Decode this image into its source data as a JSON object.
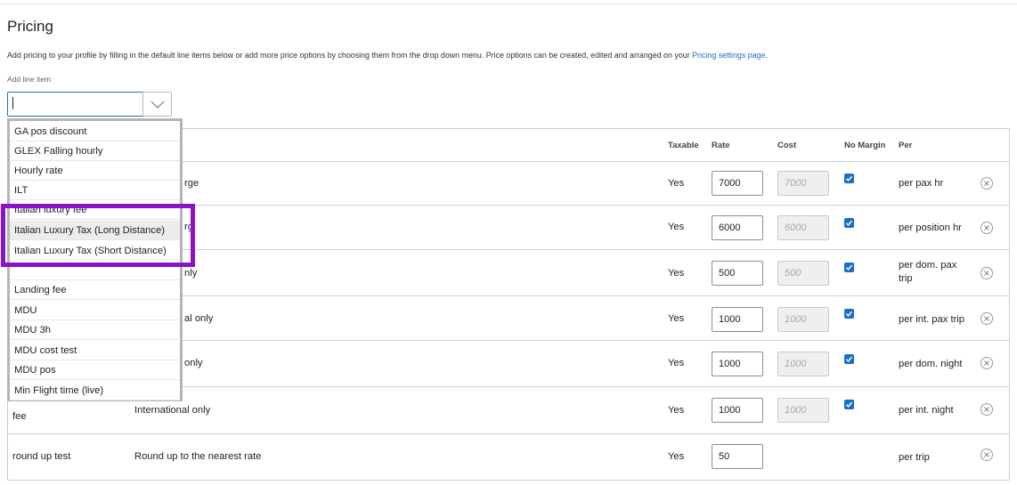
{
  "page": {
    "title": "Pricing",
    "intro_text": "Add pricing to your profile by filling in the default line items below or add more price options by choosing them from the drop down menu. Price options can be created, edited and arranged on your ",
    "intro_link": "Pricing settings page",
    "intro_end": ".",
    "add_label": "Add line item"
  },
  "combo": {
    "value": "",
    "toggle_icon": "chevron-down-icon"
  },
  "table": {
    "headers": {
      "taxable": "Taxable",
      "rate": "Rate",
      "cost": "Cost",
      "no_margin": "No Margin",
      "per": "Per"
    },
    "rows": [
      {
        "name": "",
        "description": "rge",
        "taxable": "Yes",
        "rate": "7000",
        "cost": "7000",
        "no_margin": true,
        "per": "per pax hr"
      },
      {
        "name": "",
        "description": "rg",
        "taxable": "Yes",
        "rate": "6000",
        "cost": "6000",
        "no_margin": true,
        "per": "per position hr"
      },
      {
        "name": "",
        "description": "nly",
        "taxable": "Yes",
        "rate": "500",
        "cost": "500",
        "no_margin": true,
        "per": "per dom. pax trip"
      },
      {
        "name": "",
        "description": "al only",
        "taxable": "Yes",
        "rate": "1000",
        "cost": "1000",
        "no_margin": true,
        "per": "per int. pax trip"
      },
      {
        "name": "",
        "description": "only",
        "taxable": "Yes",
        "rate": "1000",
        "cost": "1000",
        "no_margin": true,
        "per": "per dom. night"
      },
      {
        "name": "fee",
        "description": "International only",
        "taxable": "Yes",
        "rate": "1000",
        "cost": "1000",
        "no_margin": true,
        "per": "per int. night"
      },
      {
        "name": "round up test",
        "description": "Round up to the nearest rate",
        "taxable": "Yes",
        "rate": "50",
        "cost": "",
        "no_margin": false,
        "per": "per trip"
      }
    ]
  },
  "dropdown": {
    "items": [
      "GA pos discount",
      "GLEX Falling hourly",
      "Hourly rate",
      "ILT",
      "Italian luxury fee",
      "Italian Luxury Tax (Long Distance)",
      "Italian Luxury Tax (Short Distance)",
      "",
      "Landing fee",
      "MDU",
      "MDU 3h",
      "MDU cost test",
      "MDU pos",
      "Min Flight time (live)"
    ],
    "hovered_index": 5
  },
  "colors": {
    "accent": "#1a6fc4",
    "highlight": "#8c12c9",
    "border": "#cfcfcf"
  }
}
